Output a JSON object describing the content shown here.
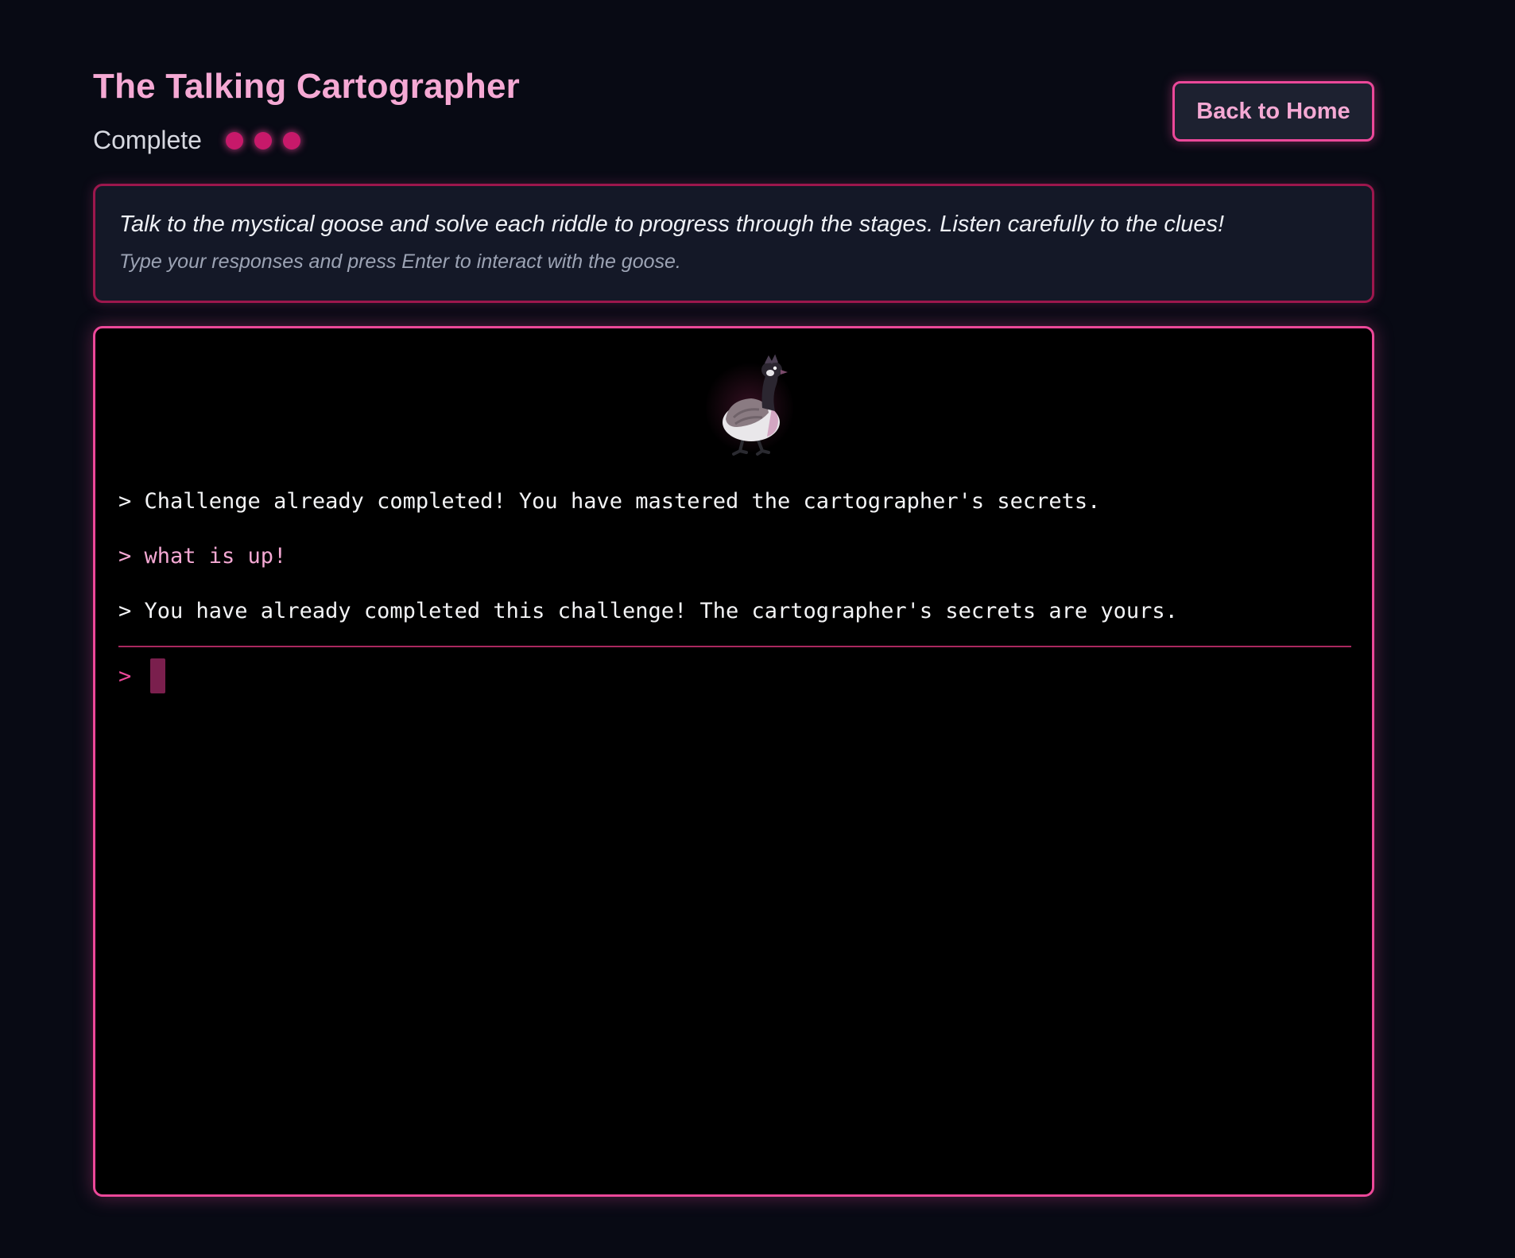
{
  "header": {
    "title": "The Talking Cartographer",
    "status_label": "Complete",
    "progress_dots": {
      "completed": 3,
      "total": 3
    },
    "back_button_label": "Back to Home"
  },
  "instructions": {
    "main": "Talk to the mystical goose and solve each riddle to progress through the stages. Listen carefully to the clues!",
    "sub": "Type your responses and press Enter to interact with the goose."
  },
  "terminal": {
    "avatar_icon": "goose-icon",
    "messages": [
      {
        "role": "system",
        "text": "> Challenge already completed! You have mastered the cartographer's secrets."
      },
      {
        "role": "user",
        "text": "> what is up!"
      },
      {
        "role": "system",
        "text": "> You have already completed this challenge! The cartographer's secrets are yours."
      }
    ],
    "prompt_symbol": ">",
    "input_value": ""
  },
  "colors": {
    "background": "#080a14",
    "accent": "#ec4899",
    "accent_light": "#f5a9d4",
    "dot": "#c7196a",
    "panel": "#141827",
    "terminal_bg": "#000000"
  }
}
